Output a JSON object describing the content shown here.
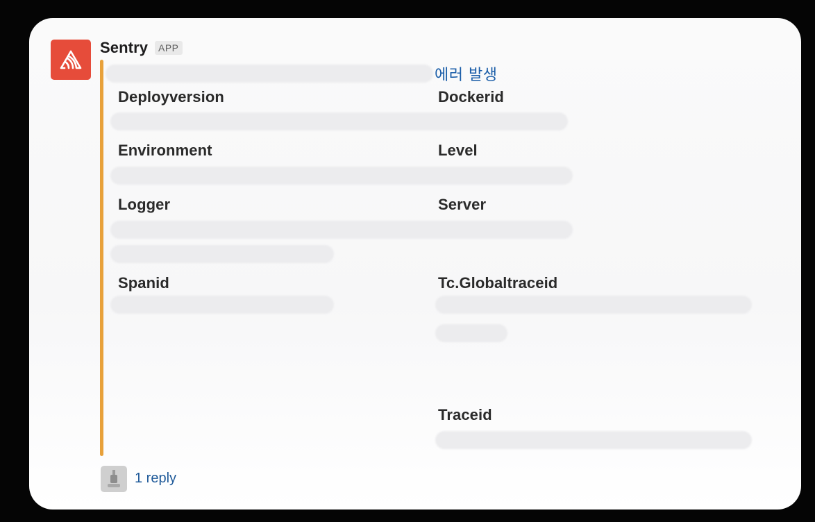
{
  "message": {
    "app_name": "Sentry",
    "app_badge": "APP",
    "app_icon": "sentry-logo-icon",
    "accent_color": "#e8a13a",
    "icon_color": "#e64c3a",
    "title": "에러 발생"
  },
  "fields": [
    {
      "label": "Deployversion"
    },
    {
      "label": "Dockerid"
    },
    {
      "label": "Environment"
    },
    {
      "label": "Level"
    },
    {
      "label": "Logger"
    },
    {
      "label": "Server"
    },
    {
      "label": "Spanid"
    },
    {
      "label": "Tc.Globaltraceid"
    },
    {
      "label": "Traceid"
    }
  ],
  "reply": {
    "text": "1 reply",
    "avatar_icon": "user-avatar-icon"
  }
}
